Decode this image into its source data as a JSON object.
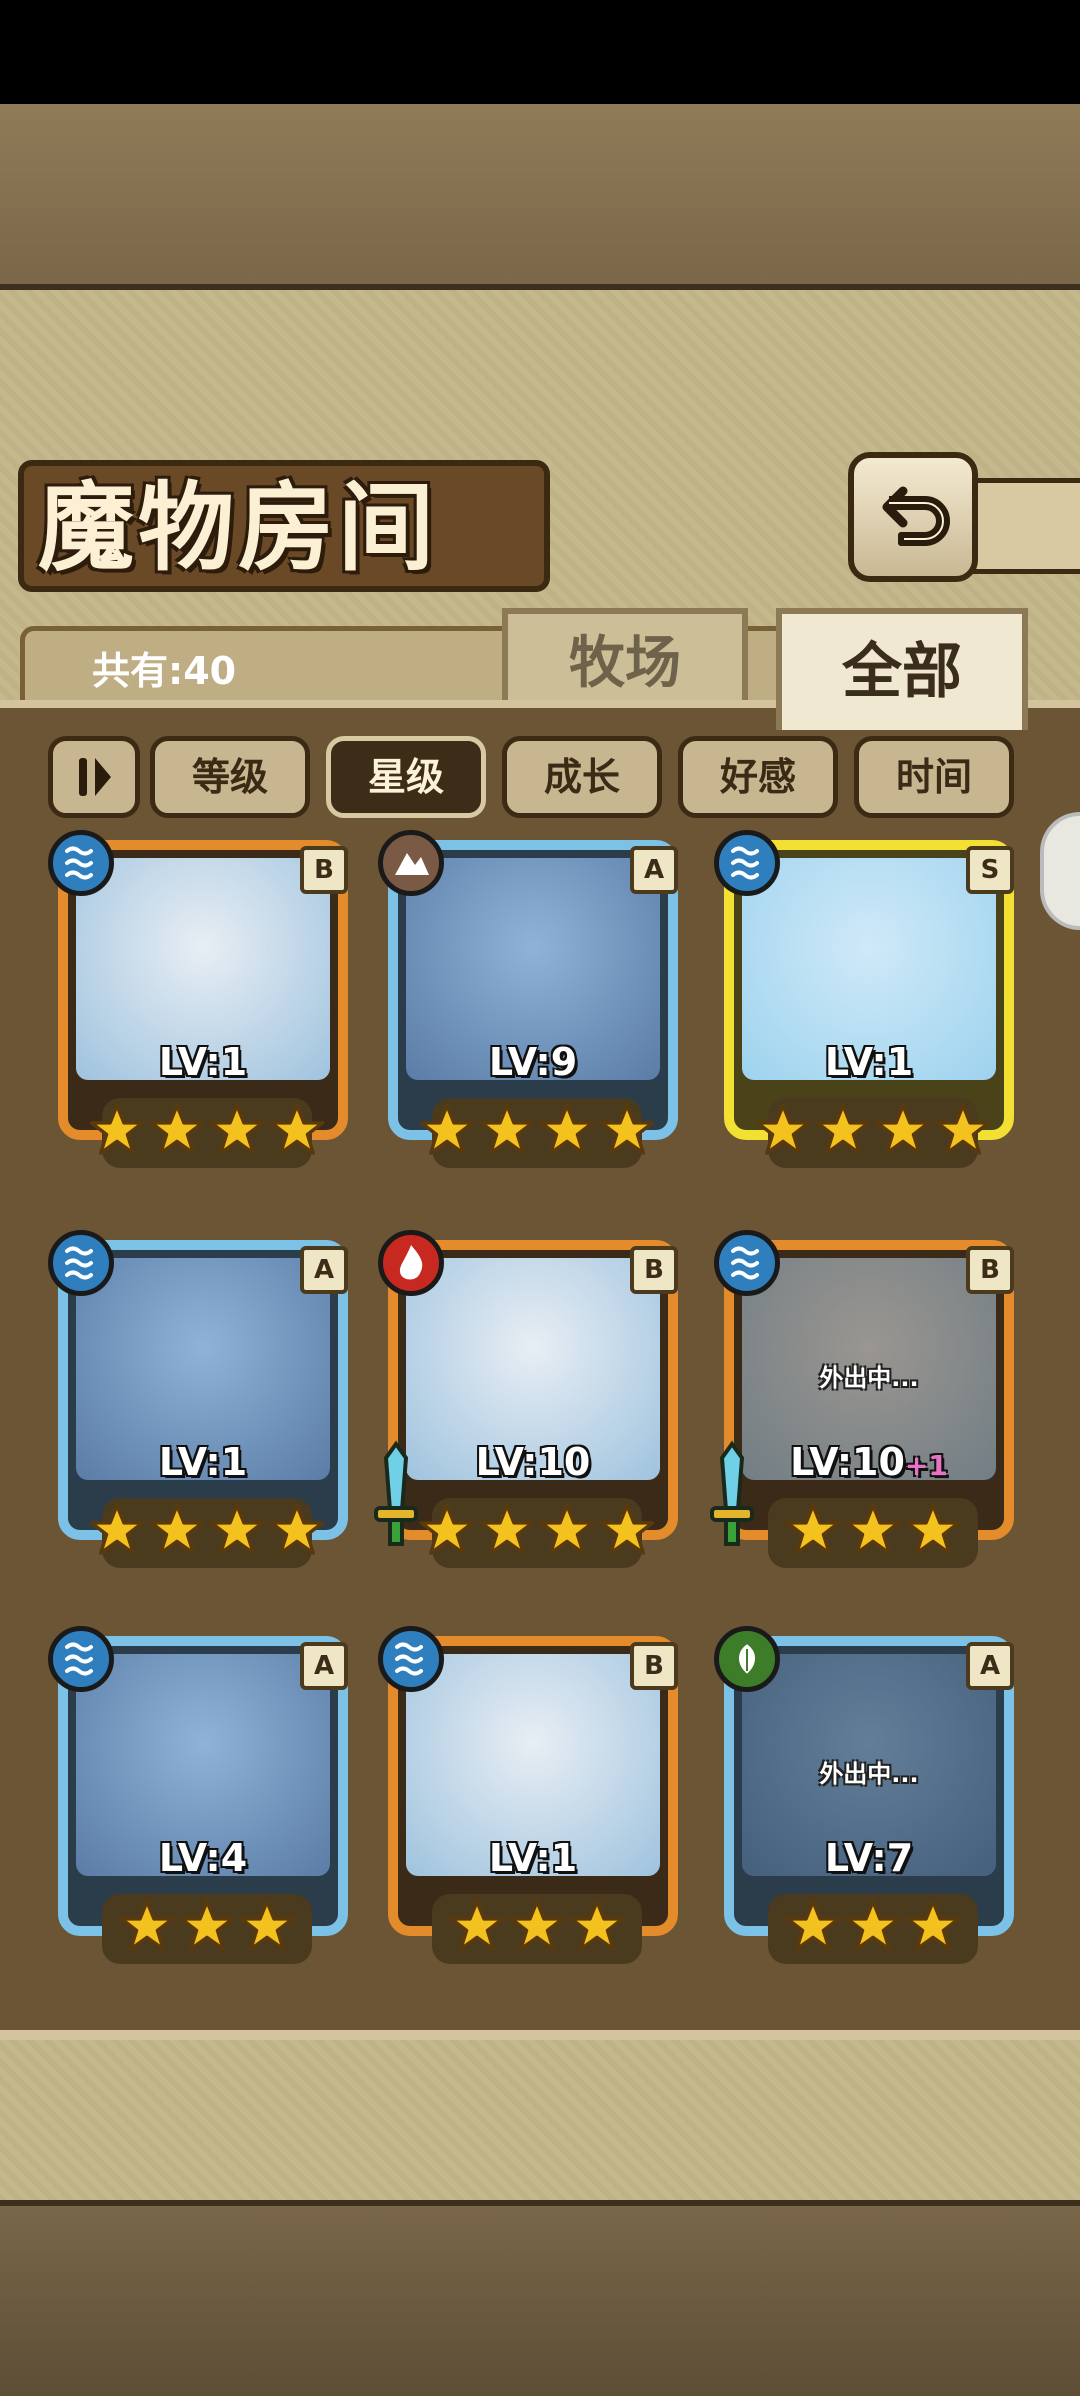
{
  "title": "魔物房间",
  "count_label": "共有:40",
  "tabs": [
    {
      "label": "牧场"
    },
    {
      "label": "全部"
    }
  ],
  "sort_buttons": [
    "等级",
    "星级",
    "成长",
    "好感",
    "时间"
  ],
  "active_sort": "星级",
  "cards": [
    {
      "lv": "LV:1",
      "plus": "",
      "rank": "B",
      "element": "water",
      "stars": 4,
      "frame": "orange",
      "away": ""
    },
    {
      "lv": "LV:9",
      "plus": "",
      "rank": "A",
      "element": "earth",
      "stars": 4,
      "frame": "blue",
      "away": ""
    },
    {
      "lv": "LV:1",
      "plus": "",
      "rank": "S",
      "element": "water",
      "stars": 4,
      "frame": "gold",
      "away": ""
    },
    {
      "lv": "LV:1",
      "plus": "",
      "rank": "A",
      "element": "water",
      "stars": 4,
      "frame": "blue",
      "away": ""
    },
    {
      "lv": "LV:10",
      "plus": "",
      "rank": "B",
      "element": "fire",
      "stars": 4,
      "frame": "orange",
      "away": ""
    },
    {
      "lv": "LV:10",
      "plus": "+1",
      "rank": "B",
      "element": "water",
      "stars": 3,
      "frame": "orange",
      "away": "外出中..."
    },
    {
      "lv": "LV:4",
      "plus": "",
      "rank": "A",
      "element": "water",
      "stars": 3,
      "frame": "blue",
      "away": ""
    },
    {
      "lv": "LV:1",
      "plus": "",
      "rank": "B",
      "element": "water",
      "stars": 3,
      "frame": "orange",
      "away": ""
    },
    {
      "lv": "LV:7",
      "plus": "",
      "rank": "A",
      "element": "wood",
      "stars": 3,
      "frame": "blue",
      "away": "外出中..."
    }
  ],
  "colors": {
    "water": "#2f7fbf",
    "earth": "#7a5a45",
    "fire": "#c7281f",
    "wood": "#3d7d2a",
    "star": "#f4c21e"
  }
}
